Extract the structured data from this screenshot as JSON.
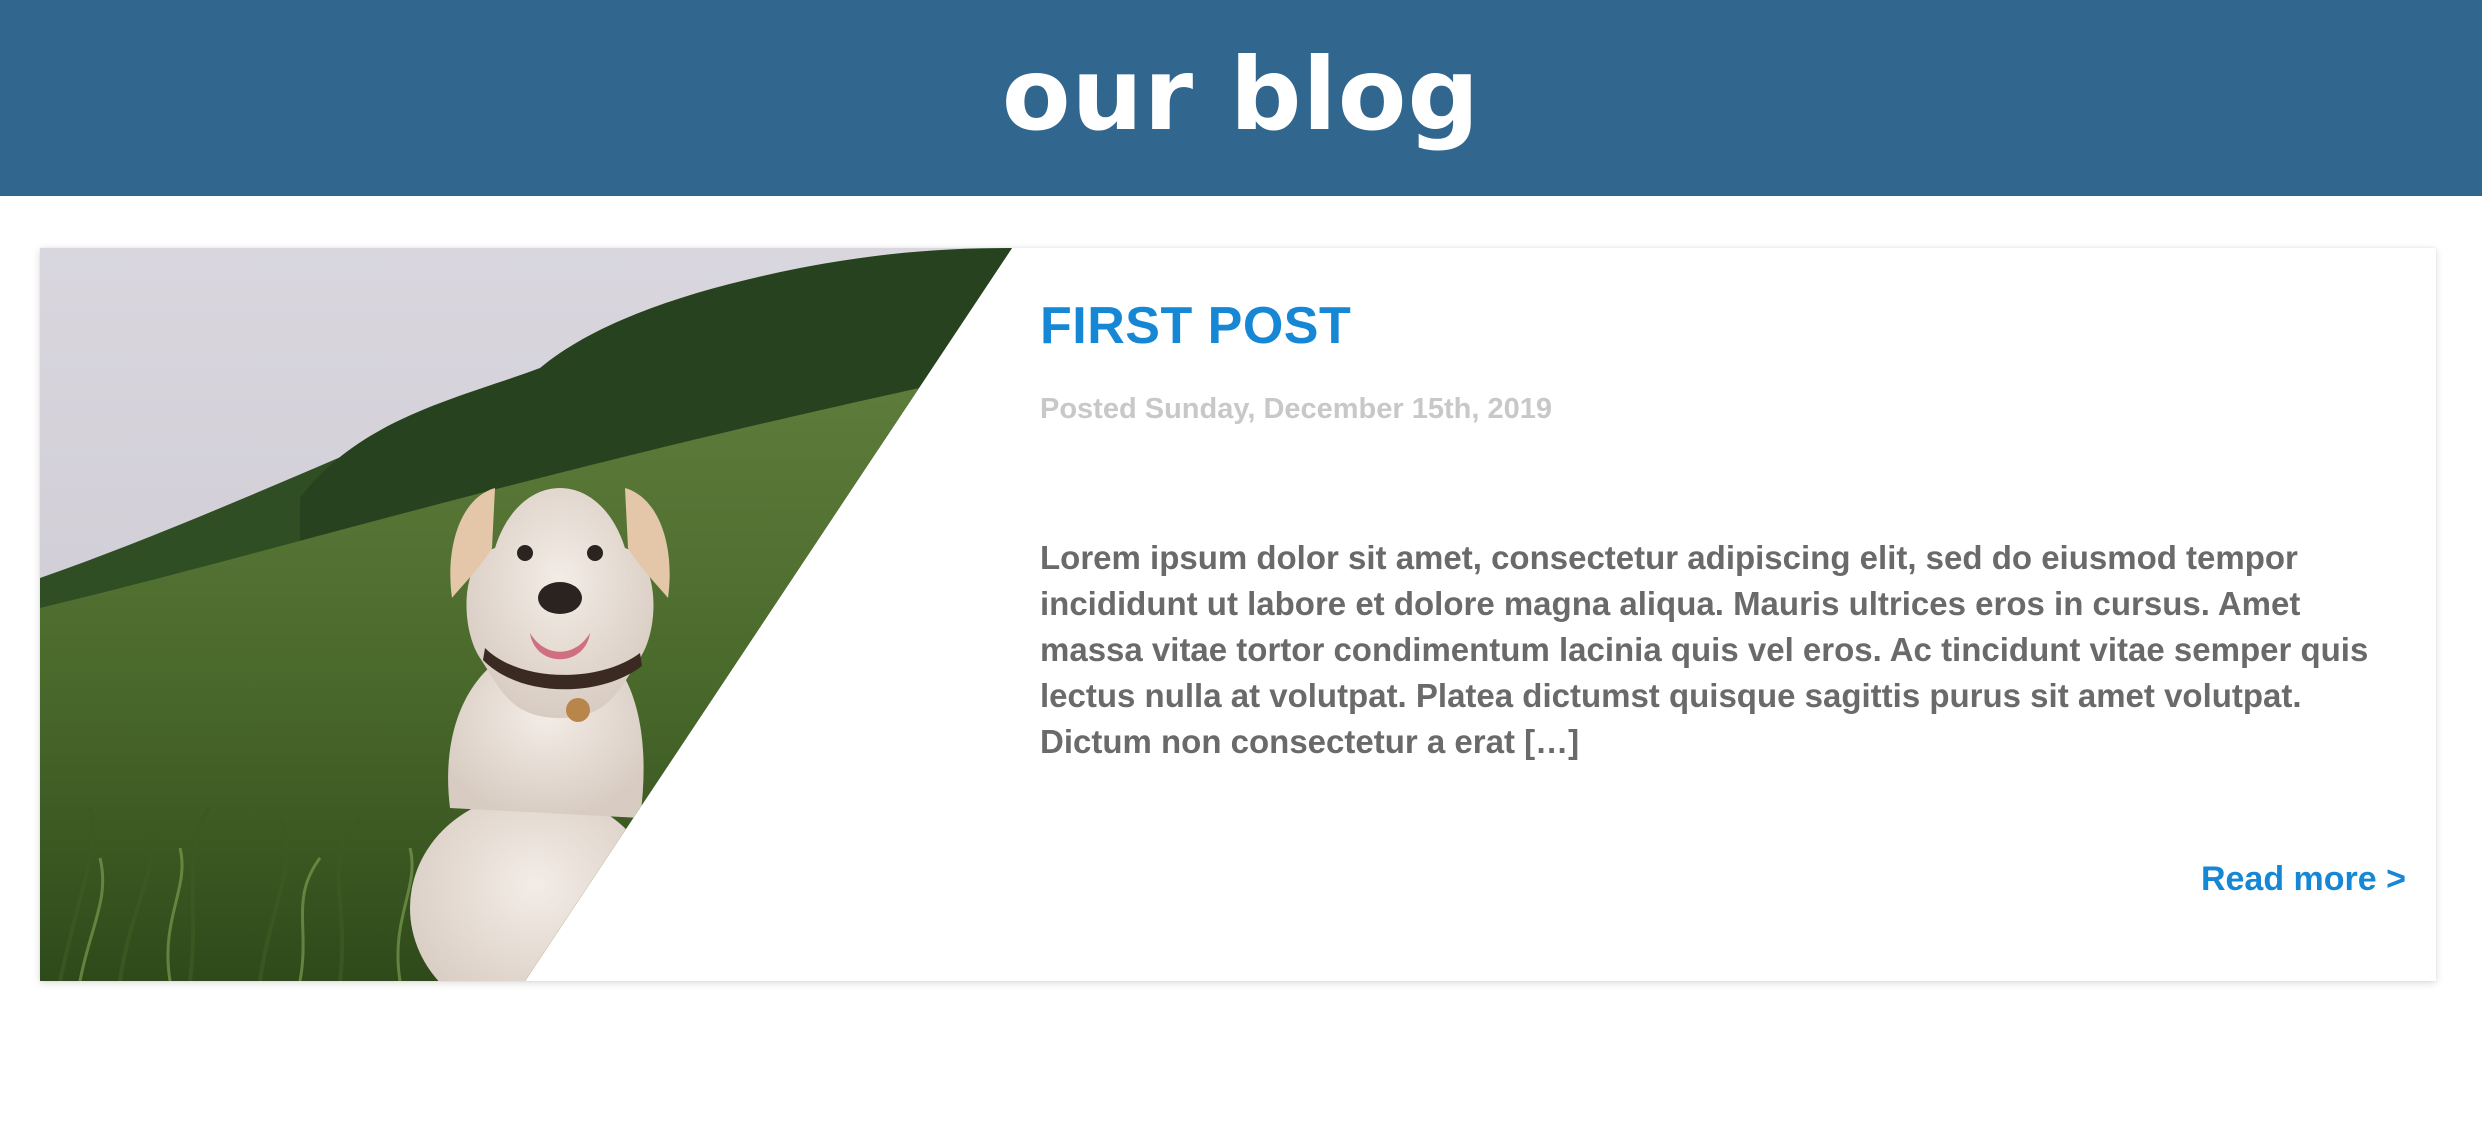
{
  "header": {
    "title": "our blog"
  },
  "post": {
    "title": "FIRST POST",
    "date": "Posted Sunday, December 15th, 2019",
    "excerpt": "Lorem ipsum dolor sit amet, consectetur adipiscing elit, sed do eiusmod tempor incididunt ut labore et dolore magna aliqua. Mauris ultrices eros in cursus. Amet massa vitae tortor condimentum lacinia quis vel eros. Ac tincidunt vitae semper quis lectus nulla at volutpat. Platea dictumst quisque sagittis purus sit amet volutpat. Dictum non consectetur a erat […]",
    "read_more_label": "Read more >",
    "image_subject": "dog-in-grass-photo"
  },
  "colors": {
    "header_bg": "#31668e",
    "accent": "#1687d4",
    "date_text": "#c8c8c8",
    "body_text": "#6a6a6a"
  }
}
